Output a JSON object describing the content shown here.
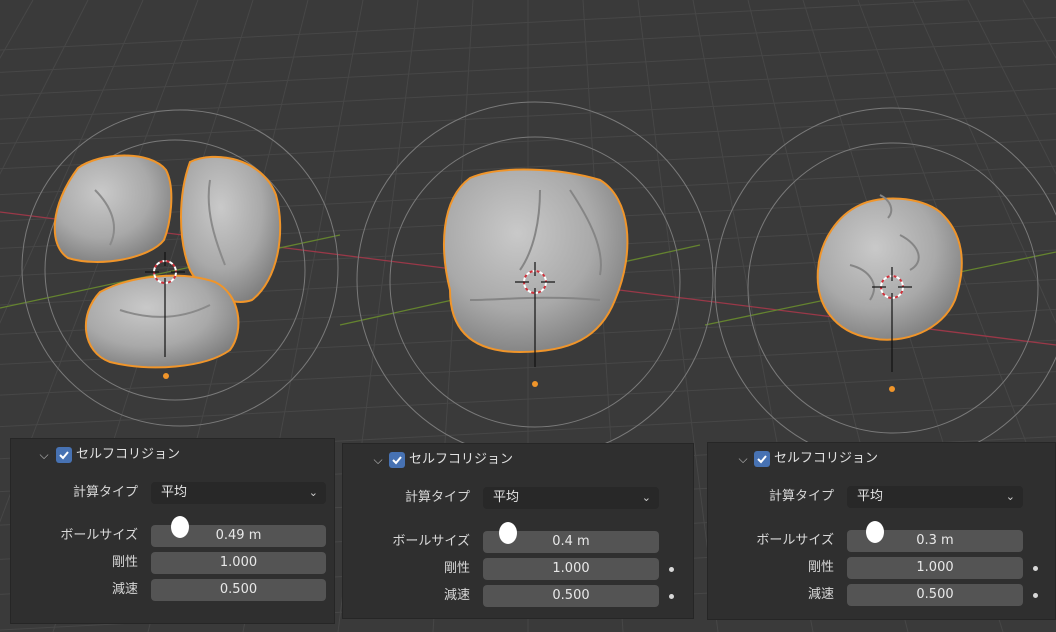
{
  "panels": [
    {
      "header_label": "セルフコリジョン",
      "calc_type_label": "計算タイプ",
      "calc_type_value": "平均",
      "ball_size_label": "ボールサイズ",
      "ball_size_value": "0.49 m",
      "stiffness_label": "剛性",
      "stiffness_value": "1.000",
      "damping_label": "減速",
      "damping_value": "0.500"
    },
    {
      "header_label": "セルフコリジョン",
      "calc_type_label": "計算タイプ",
      "calc_type_value": "平均",
      "ball_size_label": "ボールサイズ",
      "ball_size_value": "0.4 m",
      "stiffness_label": "剛性",
      "stiffness_value": "1.000",
      "damping_label": "減速",
      "damping_value": "0.500"
    },
    {
      "header_label": "セルフコリジョン",
      "calc_type_label": "計算タイプ",
      "calc_type_value": "平均",
      "ball_size_label": "ボールサイズ",
      "ball_size_value": "0.3 m",
      "stiffness_label": "剛性",
      "stiffness_value": "1.000",
      "damping_label": "減速",
      "damping_value": "0.500"
    }
  ],
  "colors": {
    "viewport_bg": "#3a3a3a",
    "grid": "#444444",
    "selection_outline": "#f0952a",
    "x_axis": "#a33a4a",
    "y_axis": "#6e8c35",
    "mesh": "#b8b8b8",
    "checkbox": "#4772b3"
  },
  "icons": [
    "chevron-down-icon",
    "checkbox-checked-icon",
    "dropdown-arrow-icon",
    "keyframe-dot-icon",
    "3d-cursor-icon",
    "origin-dot-icon"
  ]
}
